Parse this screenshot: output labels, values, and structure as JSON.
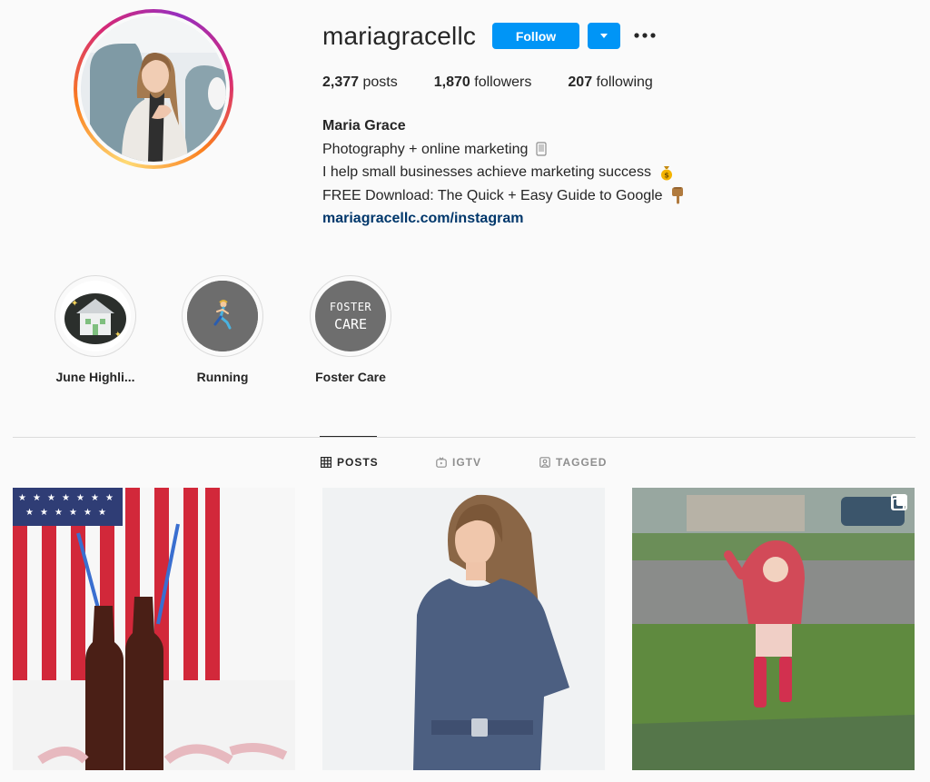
{
  "profile": {
    "username": "mariagracellc",
    "follow_label": "Follow"
  },
  "stats": {
    "posts_count": "2,377",
    "posts_label": "posts",
    "followers_count": "1,870",
    "followers_label": "followers",
    "following_count": "207",
    "following_label": "following"
  },
  "bio": {
    "name": "Maria Grace",
    "line1": "Photography + online marketing",
    "line2": "I help small businesses achieve marketing success",
    "line3": "FREE Download: The Quick + Easy Guide to Google",
    "link": "mariagracellc.com/instagram"
  },
  "highlights": [
    {
      "label": "June Highli..."
    },
    {
      "label": "Running"
    },
    {
      "label": "Foster Care",
      "cover_text_1": "FOSTER",
      "cover_text_2": "CARE"
    }
  ],
  "tabs": [
    {
      "label": "POSTS",
      "icon": "grid-icon"
    },
    {
      "label": "IGTV",
      "icon": "igtv-icon"
    },
    {
      "label": "TAGGED",
      "icon": "tagged-icon"
    }
  ],
  "colors": {
    "accent": "#0095f6",
    "link": "#00376b",
    "text": "#262626",
    "muted": "#8e8e8e",
    "background": "#fafafa",
    "divider": "#dbdbdb"
  }
}
